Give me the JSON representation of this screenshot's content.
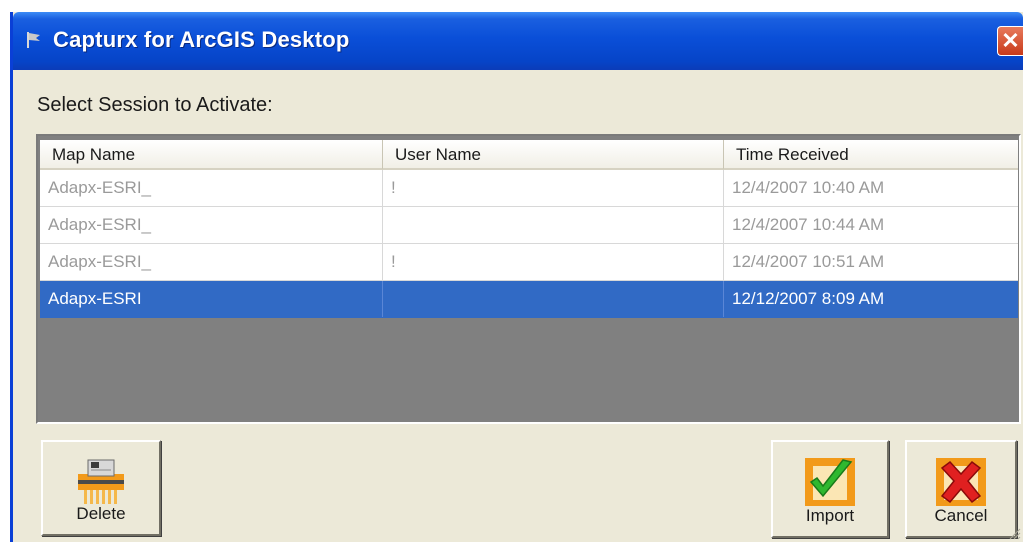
{
  "window": {
    "title": "Capturx for ArcGIS Desktop",
    "close_symbol": "✕"
  },
  "prompt": "Select Session to Activate:",
  "columns": [
    "Map Name",
    "User Name",
    "Time Received"
  ],
  "rows": [
    {
      "map_name": "Adapx-ESRI_",
      "user_name": "!",
      "time_received": "12/4/2007 10:40 AM",
      "selected": false
    },
    {
      "map_name": "Adapx-ESRI_",
      "user_name": "",
      "time_received": "12/4/2007 10:44 AM",
      "selected": false
    },
    {
      "map_name": "Adapx-ESRI_",
      "user_name": "!",
      "time_received": "12/4/2007 10:51 AM",
      "selected": false
    },
    {
      "map_name": "Adapx-ESRI",
      "user_name": "",
      "time_received": "12/12/2007 8:09 AM",
      "selected": true
    }
  ],
  "buttons": {
    "delete_label": "Delete",
    "import_label": "Import",
    "cancel_label": "Cancel"
  },
  "colors": {
    "titlebar": "#0a4fd8",
    "selection": "#316ac5",
    "list_empty_area": "#808080",
    "dialog_face": "#ece9d8"
  },
  "icons": {
    "title": "flag-icon",
    "close": "close-icon",
    "delete": "shredder-icon",
    "import": "checkmark-icon",
    "cancel": "red-x-icon"
  }
}
